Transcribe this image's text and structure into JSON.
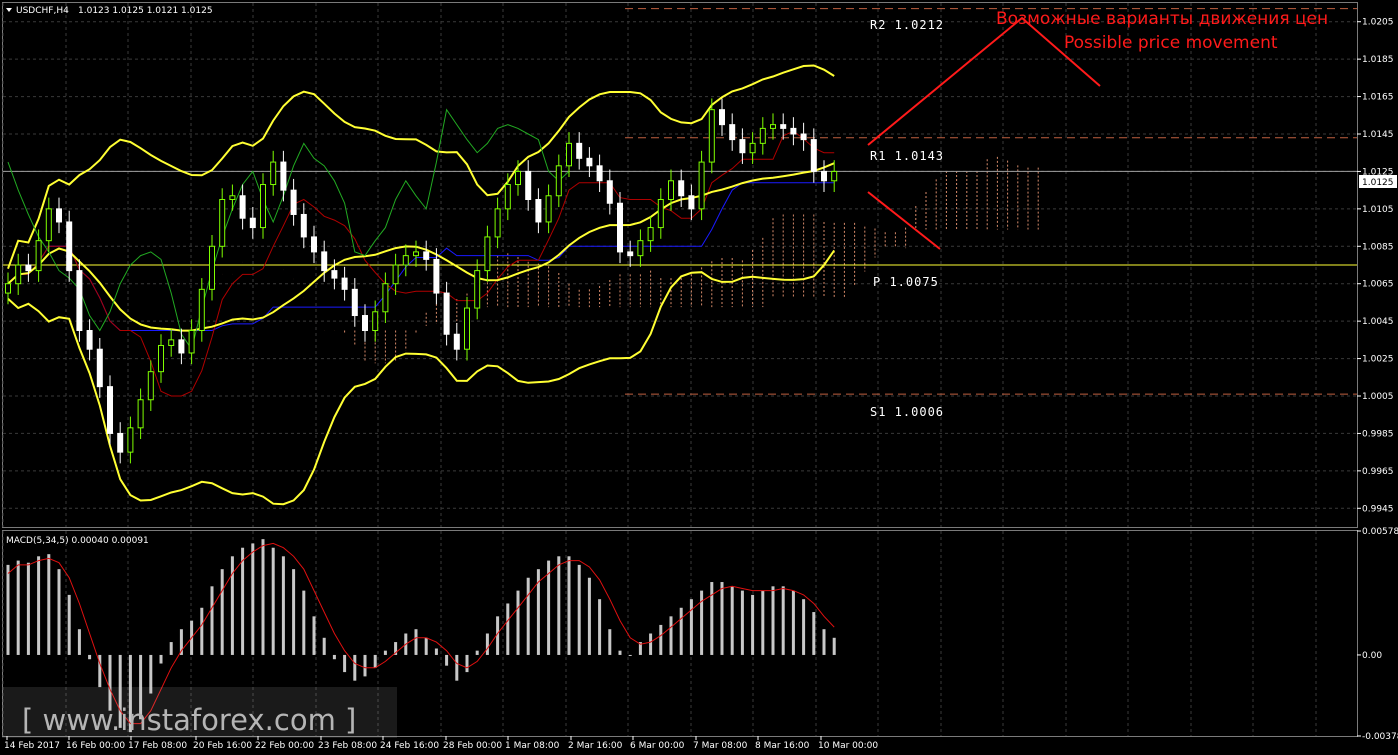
{
  "header": {
    "symbol_tf": "USDCHF,H4",
    "quote": "1.0123 1.0125 1.0121 1.0125",
    "macd_label": "MACD(5,34,5) 0.00040 0.00091"
  },
  "annotations": {
    "line1": "Возможные варианты движения цен",
    "line2": "Possible price movement"
  },
  "watermark": "[ www.instaforex.com ]",
  "levels": [
    {
      "name": "R2",
      "label": "R2  1.0212",
      "value": 1.0212
    },
    {
      "name": "R1",
      "label": "R1  1.0143",
      "value": 1.0143
    },
    {
      "name": "P",
      "label": "P  1.0075",
      "value": 1.0075
    },
    {
      "name": "S1",
      "label": "S1  1.0006",
      "value": 1.0006
    }
  ],
  "current_price_label": "1.0125",
  "colors": {
    "background": "#000000",
    "grid": "#3a3a3a",
    "bull": "#7fff00",
    "bear": "#ffffff",
    "bollinger": "#ffff33",
    "tenkan": "#b00000",
    "kijun": "#1a1aff",
    "chikou": "#22aa22",
    "cloud": "#d68a6a",
    "macd_hist": "#c8c8c8",
    "macd_signal": "#e01010",
    "levels": "#c06040",
    "pivot": "#ffff33",
    "annotation": "#ff1a1a"
  },
  "chart_data": [
    {
      "type": "candlestick",
      "title": "USDCHF,H4",
      "ylim": [
        0.9935,
        1.0215
      ],
      "y_ticks": [
        "1.0205",
        "1.0185",
        "1.0165",
        "1.0145",
        "1.0125",
        "1.0105",
        "1.0085",
        "1.0065",
        "1.0045",
        "1.0025",
        "1.0005",
        "0.9985",
        "0.9965",
        "0.9945"
      ],
      "x_ticks": [
        "14 Feb 2017",
        "16 Feb 00:00",
        "17 Feb 08:00",
        "20 Feb 16:00",
        "22 Feb 00:00",
        "23 Feb 08:00",
        "24 Feb 16:00",
        "28 Feb 00:00",
        "1 Mar 08:00",
        "2 Mar 16:00",
        "6 Mar 00:00",
        "7 Mar 08:00",
        "8 Mar 16:00",
        "10 Mar 00:00"
      ],
      "close": [
        1.0065,
        1.0075,
        1.0072,
        1.0088,
        1.0105,
        1.0098,
        1.0072,
        1.004,
        1.003,
        1.001,
        0.9985,
        0.9975,
        0.9988,
        1.0003,
        1.0018,
        1.0032,
        1.0035,
        1.0028,
        1.004,
        1.0062,
        1.0085,
        1.011,
        1.0112,
        1.01,
        1.0095,
        1.0118,
        1.013,
        1.0115,
        1.0102,
        1.009,
        1.0082,
        1.0072,
        1.0068,
        1.0062,
        1.0048,
        1.004,
        1.005,
        1.0065,
        1.0075,
        1.008,
        1.0082,
        1.0078,
        1.006,
        1.0038,
        1.003,
        1.0052,
        1.0072,
        1.009,
        1.0105,
        1.0118,
        1.0125,
        1.011,
        1.0098,
        1.0112,
        1.0128,
        1.014,
        1.0132,
        1.0128,
        1.012,
        1.0108,
        1.0082,
        1.008,
        1.0088,
        1.0095,
        1.011,
        1.012,
        1.0112,
        1.0105,
        1.013,
        1.0158,
        1.015,
        1.0142,
        1.0135,
        1.014,
        1.0148,
        1.015,
        1.0148,
        1.0145,
        1.0142,
        1.0125,
        1.012,
        1.0125
      ],
      "pivot_levels": {
        "R2": 1.0212,
        "R1": 1.0143,
        "P": 1.0075,
        "S1": 1.0006
      },
      "last_price": 1.0125
    },
    {
      "type": "bar",
      "title": "MACD(5,34,5) 0.00040 0.00091",
      "ylim": [
        -0.00378,
        0.00578
      ],
      "y_ticks": [
        "0.00578",
        "0.00",
        "-0.00378"
      ],
      "histogram": [
        0.0042,
        0.0044,
        0.0043,
        0.0046,
        0.0047,
        0.004,
        0.0028,
        0.0012,
        -0.0002,
        -0.0015,
        -0.0026,
        -0.0034,
        -0.0036,
        -0.003,
        -0.0018,
        -0.0004,
        0.0006,
        0.0012,
        0.0016,
        0.0022,
        0.0032,
        0.004,
        0.0046,
        0.005,
        0.0052,
        0.0054,
        0.005,
        0.0046,
        0.004,
        0.003,
        0.0018,
        0.0008,
        -0.0002,
        -0.0008,
        -0.0012,
        -0.001,
        -0.0006,
        0.0002,
        0.0006,
        0.001,
        0.0012,
        0.0008,
        0.0003,
        -0.0005,
        -0.0012,
        -0.0008,
        0.0002,
        0.001,
        0.0018,
        0.0024,
        0.003,
        0.0036,
        0.004,
        0.0044,
        0.0046,
        0.0046,
        0.0042,
        0.0036,
        0.0026,
        0.0012,
        0.0002,
        0.0,
        0.0006,
        0.001,
        0.0014,
        0.0018,
        0.0022,
        0.0026,
        0.003,
        0.0034,
        0.0034,
        0.0032,
        0.003,
        0.0028,
        0.003,
        0.0032,
        0.0032,
        0.003,
        0.0026,
        0.002,
        0.0012,
        0.0008
      ],
      "signal": [
        0.0038,
        0.0042,
        0.0042,
        0.0044,
        0.0045,
        0.0043,
        0.0036,
        0.0024,
        0.001,
        -0.0004,
        -0.0016,
        -0.0026,
        -0.0032,
        -0.0032,
        -0.0026,
        -0.0016,
        -0.0006,
        0.0002,
        0.0008,
        0.0014,
        0.0022,
        0.003,
        0.0038,
        0.0044,
        0.0048,
        0.0051,
        0.0052,
        0.005,
        0.0046,
        0.004,
        0.003,
        0.002,
        0.001,
        0.0002,
        -0.0004,
        -0.0006,
        -0.0006,
        -0.0003,
        0.0001,
        0.0005,
        0.0008,
        0.0008,
        0.0006,
        0.0002,
        -0.0004,
        -0.0006,
        -0.0003,
        0.0003,
        0.001,
        0.0016,
        0.0022,
        0.0028,
        0.0034,
        0.0038,
        0.0042,
        0.0044,
        0.0044,
        0.0041,
        0.0035,
        0.0026,
        0.0016,
        0.0008,
        0.0005,
        0.0006,
        0.0009,
        0.0013,
        0.0017,
        0.0021,
        0.0025,
        0.0028,
        0.0031,
        0.0032,
        0.0031,
        0.003,
        0.003,
        0.003,
        0.0031,
        0.003,
        0.0028,
        0.0024,
        0.0018,
        0.0013
      ]
    }
  ]
}
